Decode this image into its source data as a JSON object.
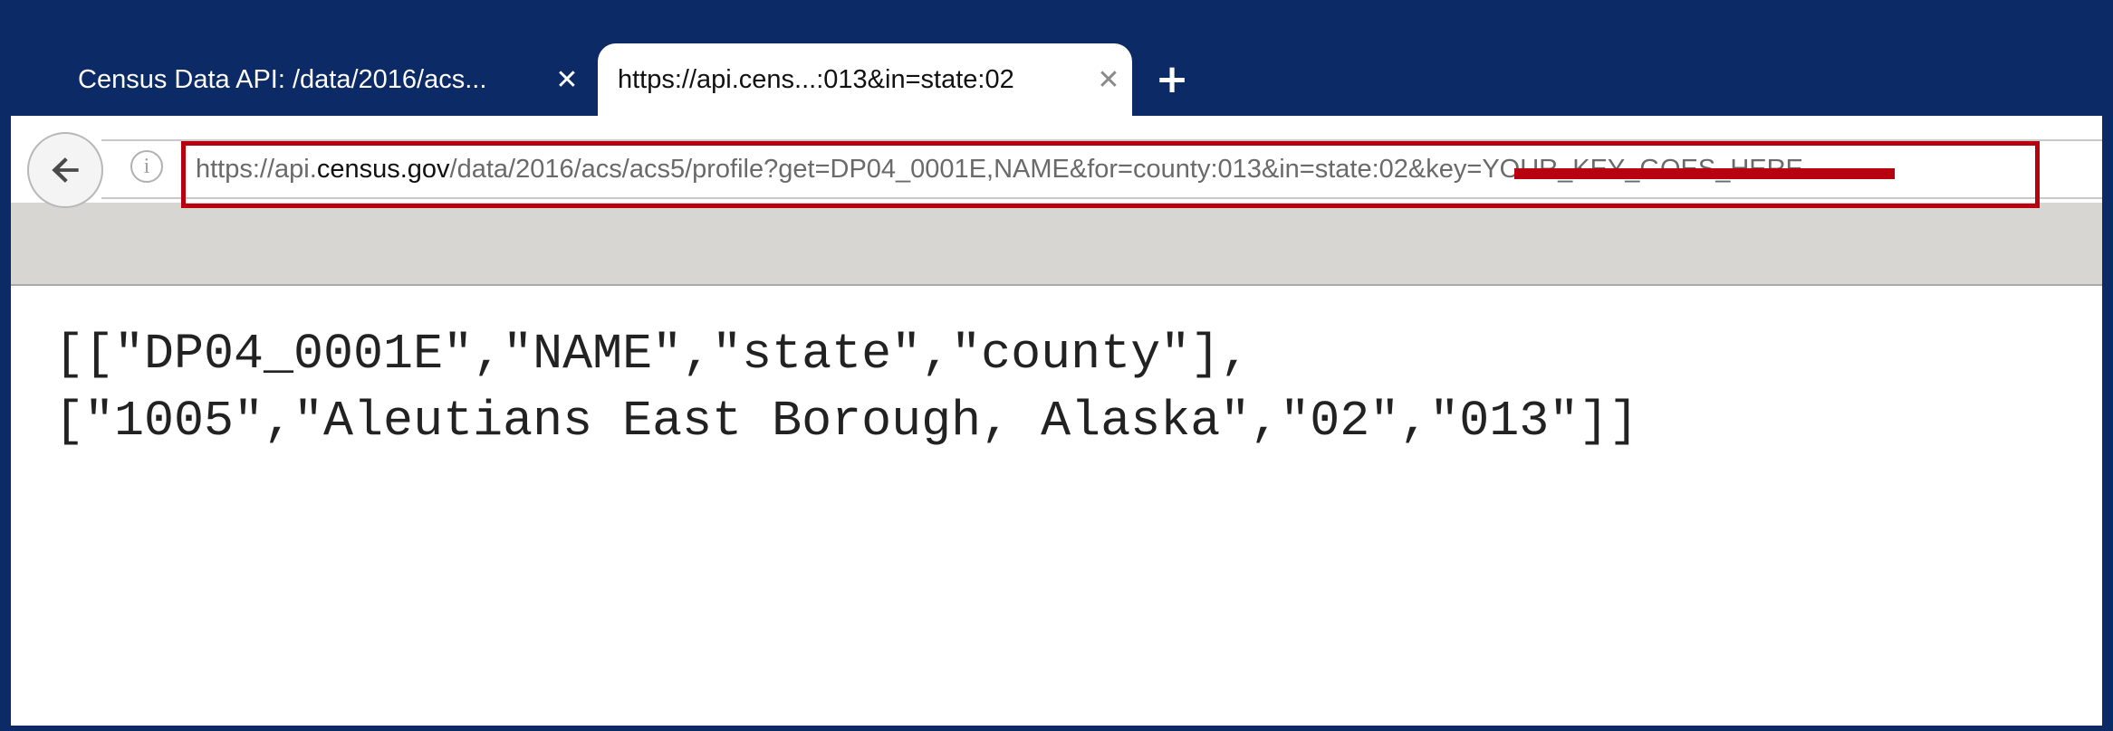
{
  "tabs": [
    {
      "title": "Census Data API: /data/2016/acs...",
      "active": false
    },
    {
      "title": "https://api.cens...:013&in=state:02",
      "active": true
    }
  ],
  "tab_close_glyph": "✕",
  "new_tab_glyph": "+",
  "url": {
    "scheme_prefix": "https://api.",
    "host": "census.gov",
    "path": "/data/2016/acs/acs5/profile?get=DP04_0001E,NAME&for=county:013&in=state:02&key=YOUR_KEY_GOES_HERE"
  },
  "icons": {
    "back": "back-arrow-icon",
    "info": "info-icon",
    "close": "close-icon",
    "new_tab": "plus-icon"
  },
  "info_glyph": "i",
  "content": {
    "line1": "[[\"DP04_0001E\",\"NAME\",\"state\",\"county\"],",
    "line2": "[\"1005\",\"Aleutians East Borough, Alaska\",\"02\",\"013\"]]"
  },
  "colors": {
    "chrome_blue": "#0c2a66",
    "highlight_red": "#b8000e",
    "toolbar_gray": "#d8d6d2"
  }
}
